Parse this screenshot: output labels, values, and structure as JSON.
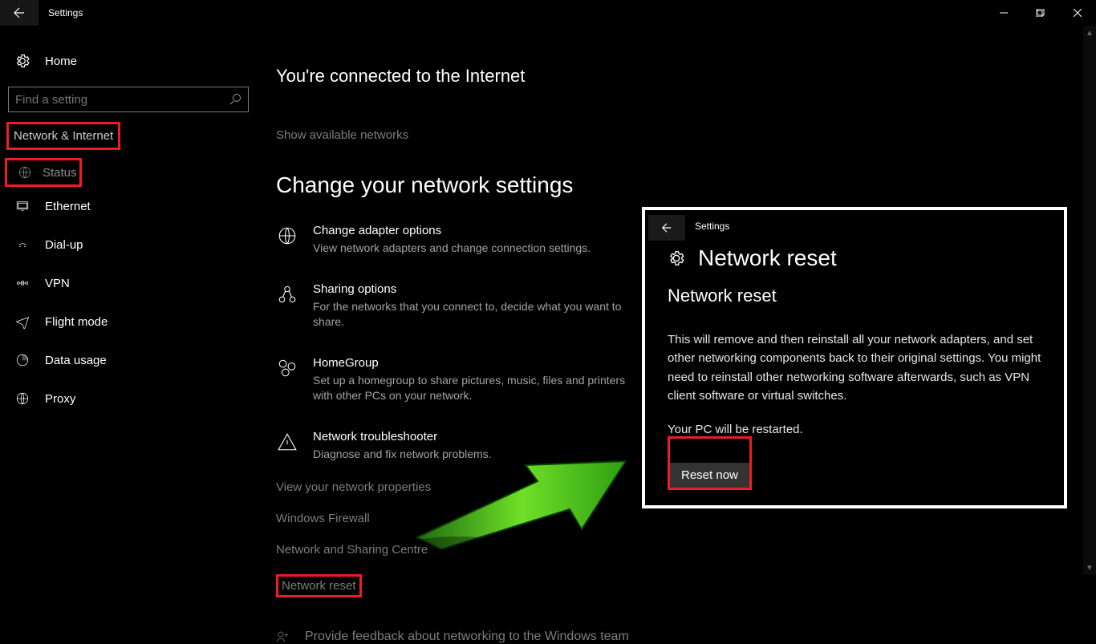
{
  "titlebar": {
    "title": "Settings"
  },
  "sidebar": {
    "home": "Home",
    "search_placeholder": "Find a setting",
    "section": "Network & Internet",
    "items": [
      {
        "label": "Status"
      },
      {
        "label": "Ethernet"
      },
      {
        "label": "Dial-up"
      },
      {
        "label": "VPN"
      },
      {
        "label": "Flight mode"
      },
      {
        "label": "Data usage"
      },
      {
        "label": "Proxy"
      }
    ]
  },
  "main": {
    "connected": "You're connected to the Internet",
    "show_networks": "Show available networks",
    "change_heading": "Change your network settings",
    "rows": [
      {
        "title": "Change adapter options",
        "sub": "View network adapters and change connection settings."
      },
      {
        "title": "Sharing options",
        "sub": "For the networks that you connect to, decide what you want to share."
      },
      {
        "title": "HomeGroup",
        "sub": "Set up a homegroup to share pictures, music, files and printers with other PCs on your network."
      },
      {
        "title": "Network troubleshooter",
        "sub": "Diagnose and fix network problems."
      }
    ],
    "links": [
      "View your network properties",
      "Windows Firewall",
      "Network and Sharing Centre",
      "Network reset"
    ],
    "feedback": "Provide feedback about networking to the Windows team"
  },
  "overlay": {
    "title": "Settings",
    "heading": "Network reset",
    "subheading": "Network reset",
    "para1": "This will remove and then reinstall all your network adapters, and set other networking components back to their original settings. You might need to reinstall other networking software afterwards, such as VPN client software or virtual switches.",
    "para2": "Your PC will be restarted.",
    "button": "Reset now"
  }
}
